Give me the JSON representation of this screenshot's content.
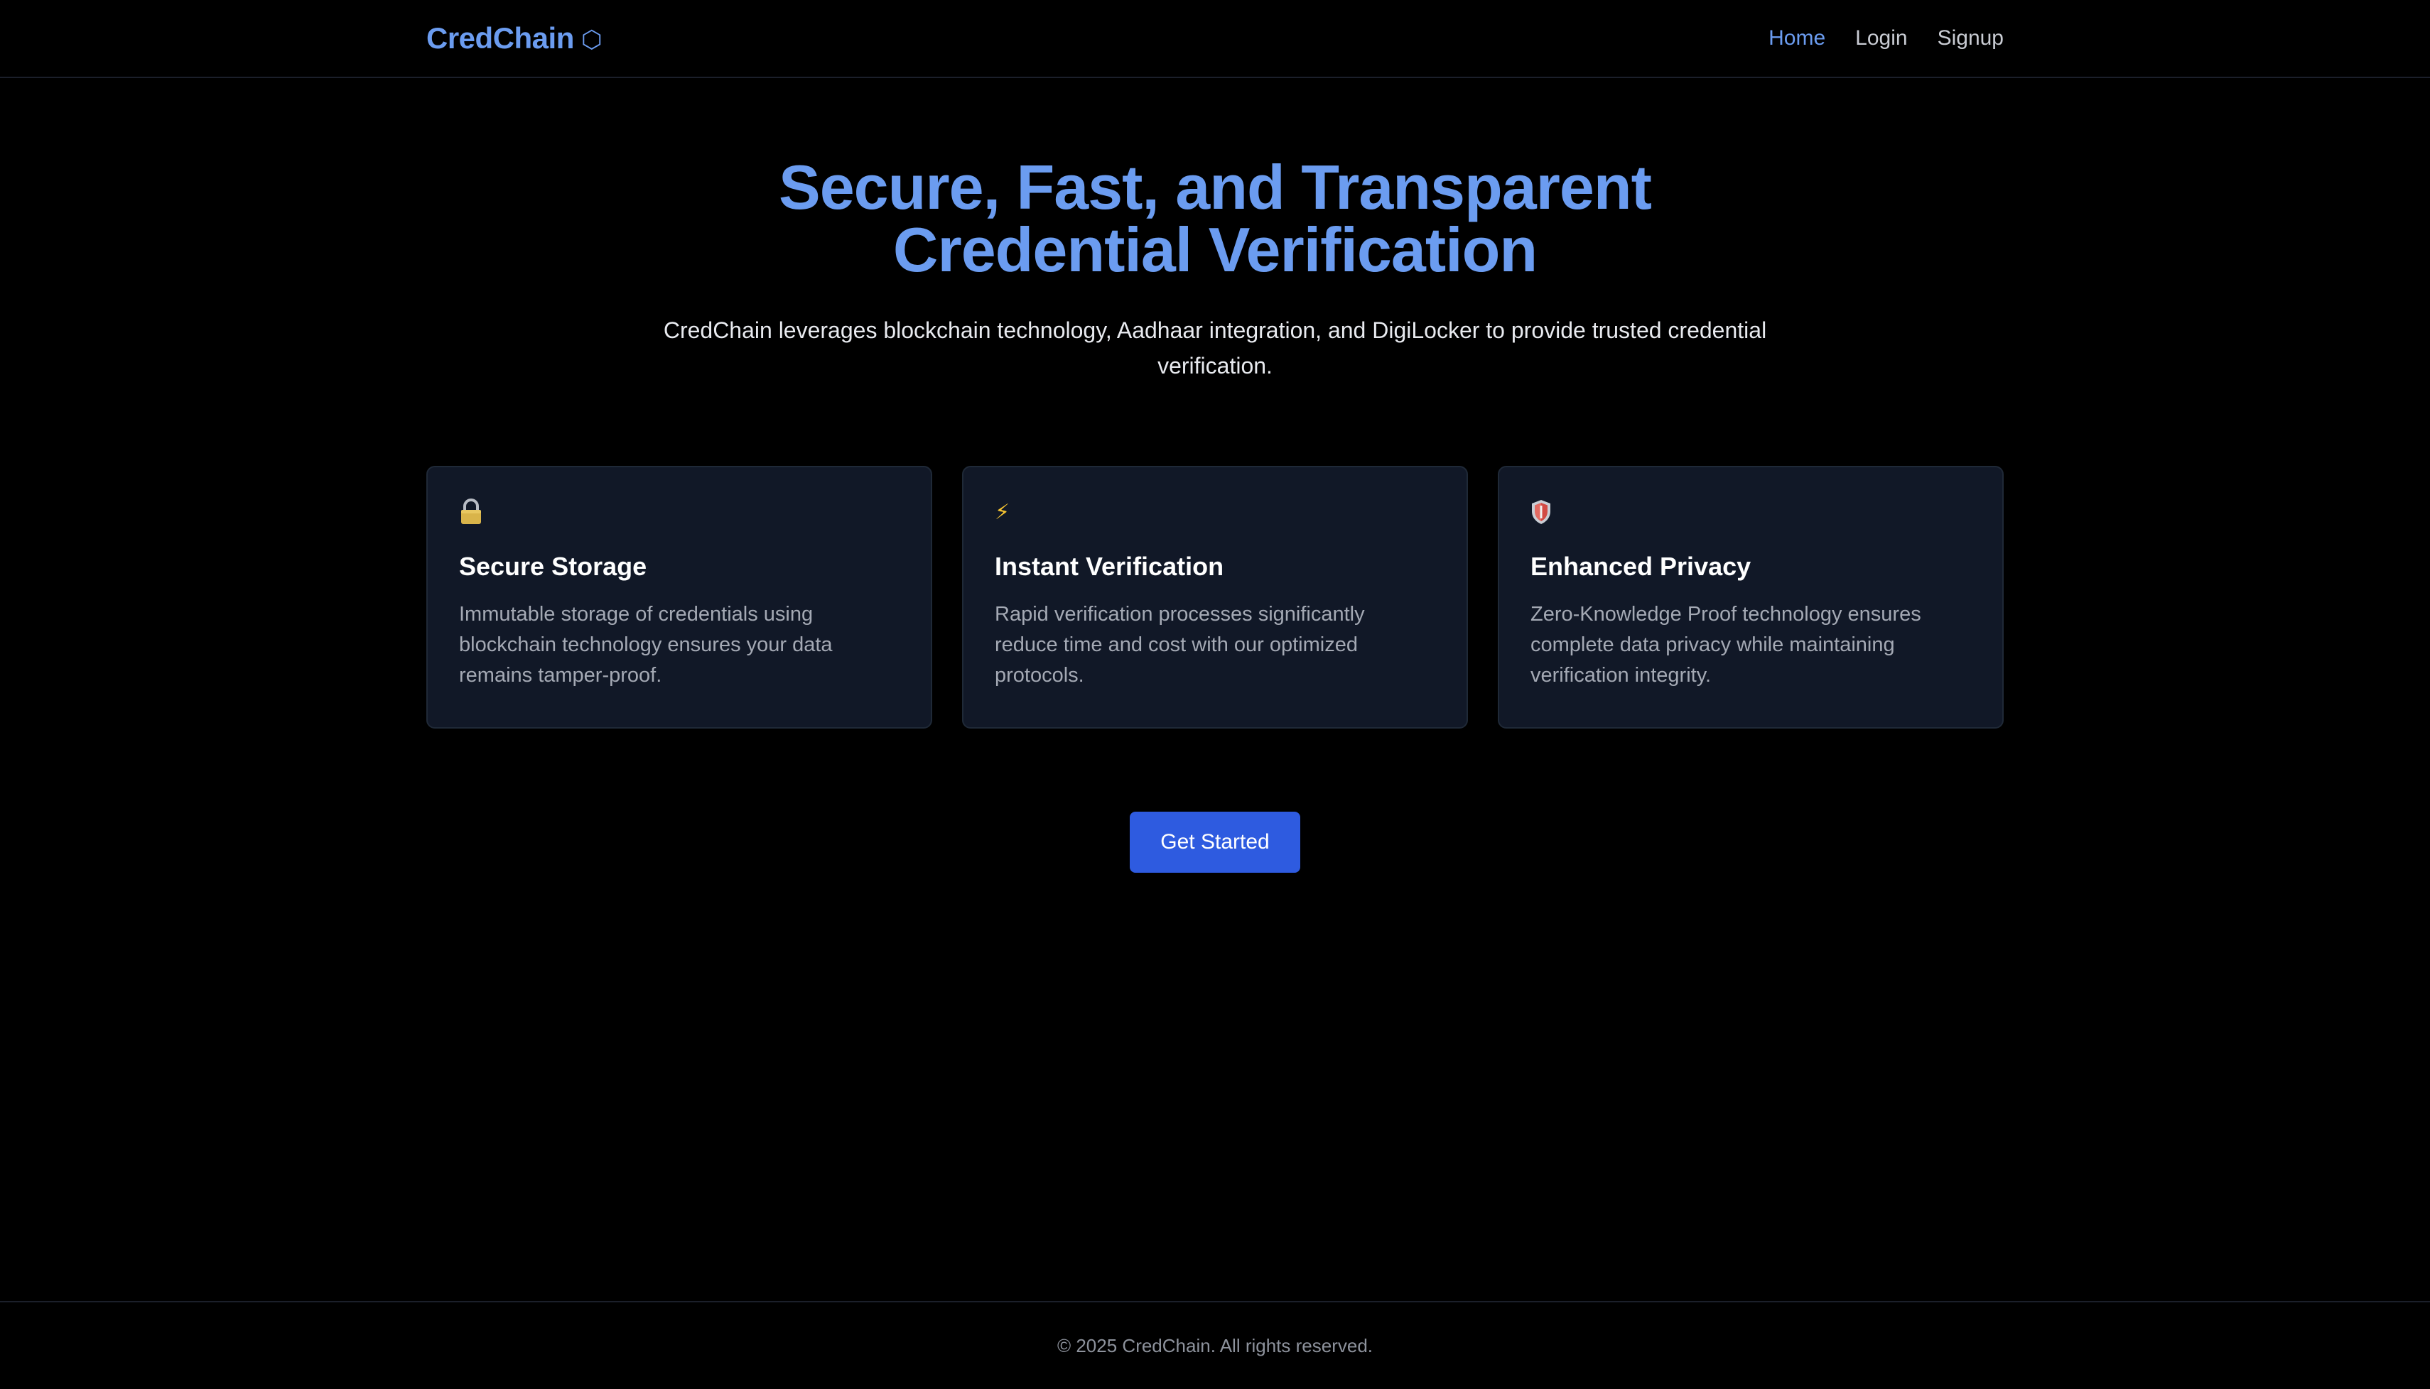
{
  "brand": {
    "name": "CredChain",
    "icon_glyph": "⬡",
    "color": "#6b9cf0"
  },
  "nav": {
    "items": [
      {
        "label": "Home",
        "active": true
      },
      {
        "label": "Login",
        "active": false
      },
      {
        "label": "Signup",
        "active": false
      }
    ]
  },
  "hero": {
    "title_line1": "Secure, Fast, and Transparent",
    "title_line2": "Credential Verification",
    "subtitle": "CredChain leverages blockchain technology, Aadhaar integration, and DigiLocker to provide trusted credential verification."
  },
  "features": [
    {
      "icon": "lock-icon",
      "title": "Secure Storage",
      "description": "Immutable storage of credentials using blockchain technology ensures your data remains tamper-proof."
    },
    {
      "icon": "lightning-icon",
      "icon_glyph": "⚡",
      "title": "Instant Verification",
      "description": "Rapid verification processes significantly reduce time and cost with our optimized protocols."
    },
    {
      "icon": "shield-icon",
      "title": "Enhanced Privacy",
      "description": "Zero-Knowledge Proof technology ensures complete data privacy while maintaining verification integrity."
    }
  ],
  "cta": {
    "label": "Get Started",
    "color": "#2e5be0"
  },
  "footer": {
    "text": "© 2025 CredChain. All rights reserved."
  }
}
